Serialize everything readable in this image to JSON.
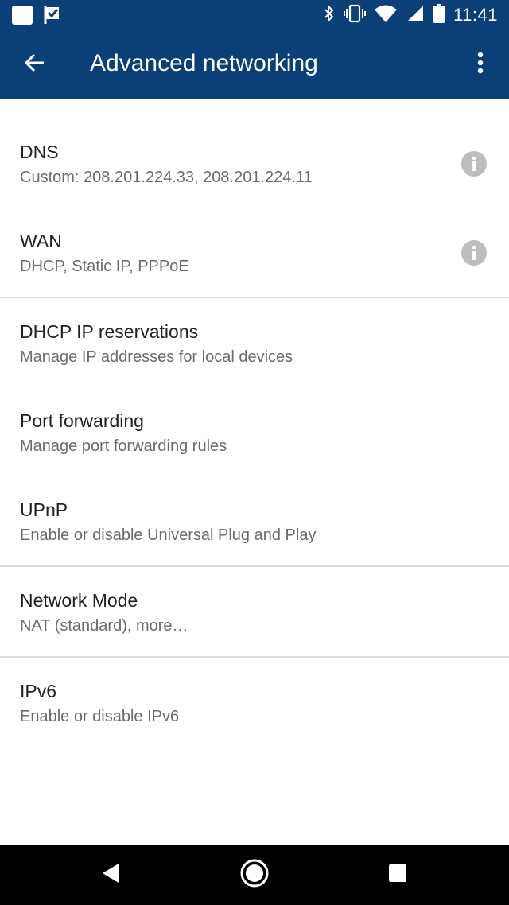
{
  "status_bar": {
    "time": "11:41",
    "icons": [
      "square-notification-icon",
      "check-flag-icon",
      "bluetooth-icon",
      "vibrate-icon",
      "wifi-icon",
      "cell-signal-icon",
      "battery-icon"
    ]
  },
  "app_bar": {
    "title": "Advanced networking",
    "back_icon": "arrow-back-icon",
    "menu_icon": "more-vert-icon",
    "background_color": "#0b3f78"
  },
  "settings": [
    {
      "title": "DNS",
      "subtitle": "Custom: 208.201.224.33, 208.201.224.11",
      "has_info": true
    },
    {
      "title": "WAN",
      "subtitle": "DHCP, Static IP, PPPoE",
      "has_info": true
    },
    {
      "title": "DHCP IP reservations",
      "subtitle": "Manage IP addresses for local devices",
      "has_info": false
    },
    {
      "title": "Port forwarding",
      "subtitle": "Manage port forwarding rules",
      "has_info": false
    },
    {
      "title": "UPnP",
      "subtitle": "Enable or disable Universal Plug and Play",
      "has_info": false
    },
    {
      "title": "Network Mode",
      "subtitle": "NAT (standard), more…",
      "has_info": false
    },
    {
      "title": "IPv6",
      "subtitle": "Enable or disable IPv6",
      "has_info": false
    }
  ],
  "nav_bar": {
    "buttons": [
      "back-triangle-icon",
      "home-circle-icon",
      "recents-square-icon"
    ]
  }
}
